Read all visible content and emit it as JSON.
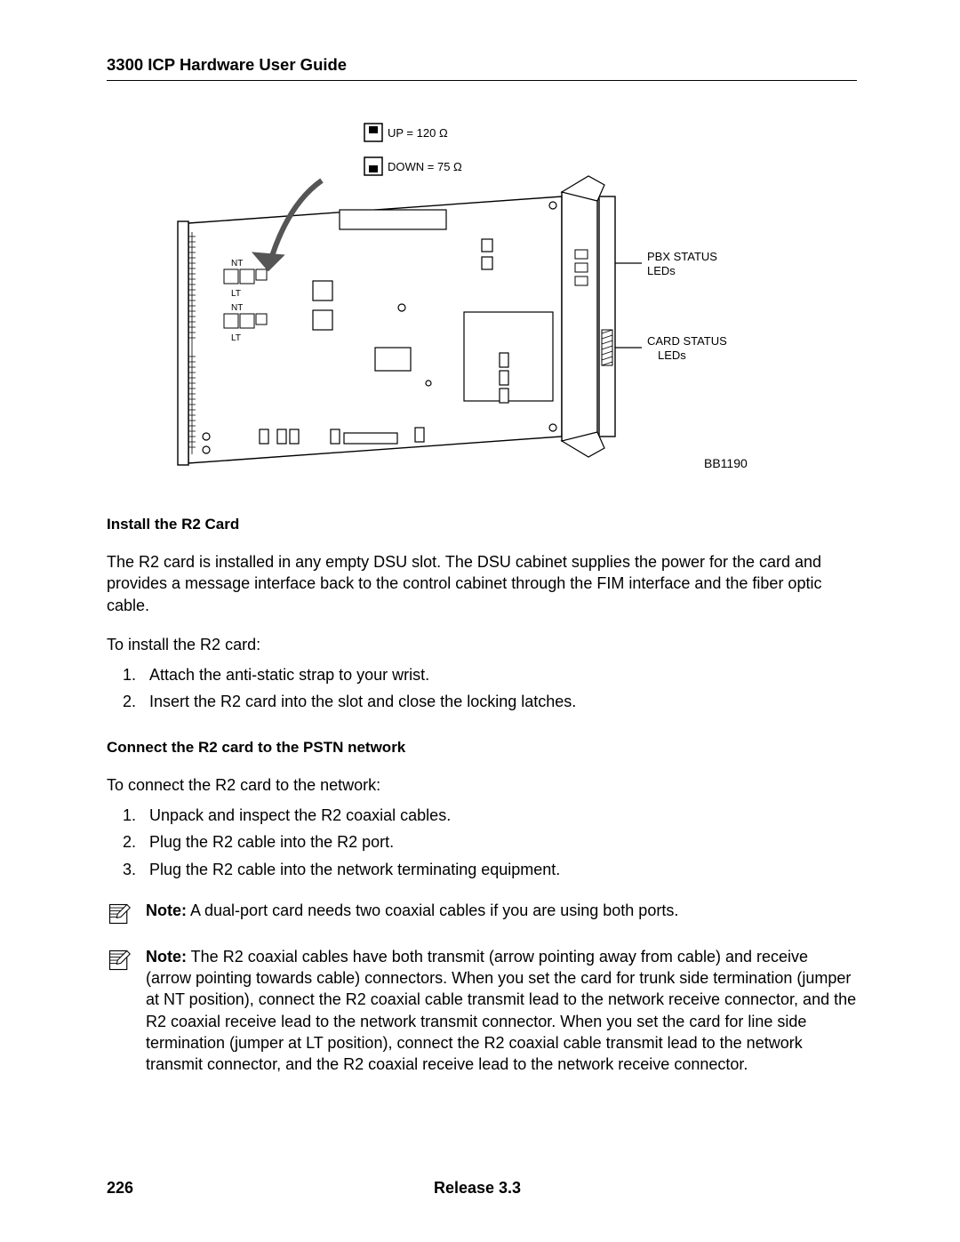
{
  "header": {
    "title": "3300 ICP Hardware User Guide"
  },
  "figure": {
    "switch_up": "UP = 120 Ω",
    "switch_down": "DOWN = 75 Ω",
    "label_pbx": "PBX STATUS",
    "label_pbx2": "LEDs",
    "label_card": "CARD STATUS",
    "label_card2": "LEDs",
    "ref": "BB1190",
    "nt": "NT",
    "lt": "LT"
  },
  "sections": {
    "install": {
      "heading": "Install the R2 Card",
      "p1": "The R2 card is installed in any empty DSU slot. The DSU cabinet supplies the power for the card and provides a message interface back to the control cabinet through the FIM interface and the fiber optic cable.",
      "p2": "To install the R2 card:",
      "steps": [
        "Attach the anti-static strap to your wrist.",
        "Insert the R2 card into the slot and close the locking latches."
      ]
    },
    "connect": {
      "heading": "Connect the R2 card to the PSTN network",
      "p1": "To connect the R2 card to the network:",
      "steps": [
        "Unpack and inspect the R2 coaxial cables.",
        "Plug the R2 cable into the R2 port.",
        "Plug the R2 cable into the network terminating equipment."
      ]
    }
  },
  "notes": {
    "label": "Note:",
    "n1": " A dual-port card needs two coaxial cables if you are using both ports.",
    "n2": " The R2 coaxial cables have both transmit (arrow pointing away from cable) and receive (arrow pointing towards cable) connectors. When you set the card for trunk side termination (jumper at NT position), connect the R2 coaxial cable transmit lead to the network receive connector, and the R2 coaxial receive lead to the network transmit connector. When you set the card for line side termination (jumper at LT position), connect the R2 coaxial cable transmit lead to the network transmit connector, and the R2 coaxial receive lead to the network receive connector."
  },
  "footer": {
    "page": "226",
    "release": "Release 3.3"
  }
}
